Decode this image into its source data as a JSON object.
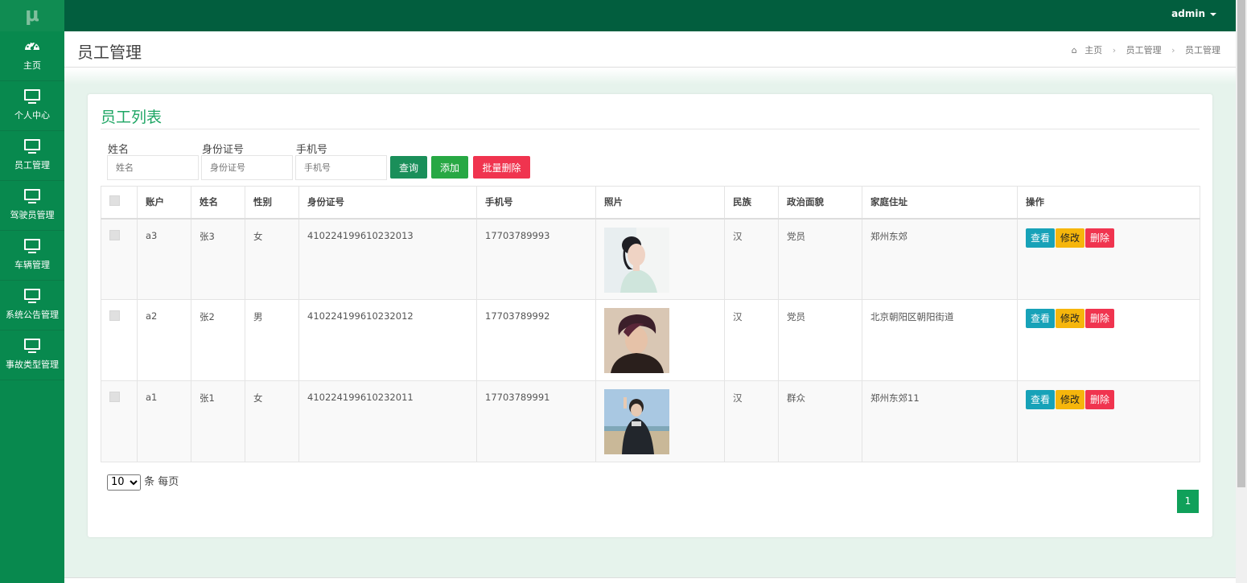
{
  "app": {
    "logo": "μ",
    "user_menu": "admin"
  },
  "sidebar": {
    "items": [
      {
        "label": "主页",
        "icon": "dashboard-icon"
      },
      {
        "label": "个人中心",
        "icon": "monitor-icon"
      },
      {
        "label": "员工管理",
        "icon": "monitor-icon"
      },
      {
        "label": "驾驶员管理",
        "icon": "monitor-icon"
      },
      {
        "label": "车辆管理",
        "icon": "monitor-icon"
      },
      {
        "label": "系统公告管理",
        "icon": "monitor-icon"
      },
      {
        "label": "事故类型管理",
        "icon": "monitor-icon"
      }
    ]
  },
  "header": {
    "title": "员工管理",
    "breadcrumb": [
      "主页",
      "员工管理",
      "员工管理"
    ]
  },
  "panel": {
    "title": "员工列表",
    "filters": [
      {
        "label": "姓名",
        "placeholder": "姓名"
      },
      {
        "label": "身份证号",
        "placeholder": "身份证号"
      },
      {
        "label": "手机号",
        "placeholder": "手机号"
      }
    ],
    "buttons": {
      "query": "查询",
      "add": "添加",
      "batch_delete": "批量删除"
    }
  },
  "table": {
    "columns": [
      "",
      "账户",
      "姓名",
      "性别",
      "身份证号",
      "手机号",
      "照片",
      "民族",
      "政治面貌",
      "家庭住址",
      "操作"
    ],
    "rows": [
      {
        "account": "a3",
        "name": "张3",
        "gender": "女",
        "id_number": "410224199610232013",
        "phone": "17703789993",
        "ethnicity": "汉",
        "political": "党员",
        "address": "郑州东郊"
      },
      {
        "account": "a2",
        "name": "张2",
        "gender": "男",
        "id_number": "410224199610232012",
        "phone": "17703789992",
        "ethnicity": "汉",
        "political": "党员",
        "address": "北京朝阳区朝阳街道"
      },
      {
        "account": "a1",
        "name": "张1",
        "gender": "女",
        "id_number": "410224199610232011",
        "phone": "17703789991",
        "ethnicity": "汉",
        "political": "群众",
        "address": "郑州东郊11"
      }
    ],
    "actions": {
      "view": "查看",
      "edit": "修改",
      "delete": "删除"
    }
  },
  "pagination": {
    "page_size": "10",
    "page_size_suffix": "条 每页",
    "current_page": "1"
  },
  "colors": {
    "topbar": "#025e3e",
    "sidebar": "#08894e",
    "accent": "#1ea664",
    "danger": "#f0344f",
    "info": "#17a2b8",
    "warning": "#f6b60c"
  }
}
